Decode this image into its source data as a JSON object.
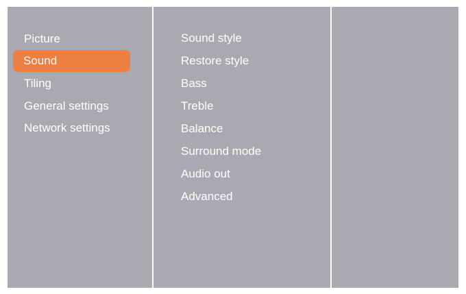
{
  "colors": {
    "screen_background": "#a9a9b1",
    "divider": "#ffffff",
    "text": "#ffffff",
    "selection_highlight": "#ec7f41"
  },
  "main_menu": {
    "items": [
      {
        "label": "Picture"
      },
      {
        "label": "Sound"
      },
      {
        "label": "Tiling"
      },
      {
        "label": "General settings"
      },
      {
        "label": "Network settings"
      }
    ],
    "selected": "Sound"
  },
  "sound_menu": {
    "items": [
      {
        "label": "Sound style"
      },
      {
        "label": "Restore style"
      },
      {
        "label": "Bass"
      },
      {
        "label": "Treble"
      },
      {
        "label": "Balance"
      },
      {
        "label": "Surround mode"
      },
      {
        "label": "Audio out"
      },
      {
        "label": "Advanced"
      }
    ]
  }
}
